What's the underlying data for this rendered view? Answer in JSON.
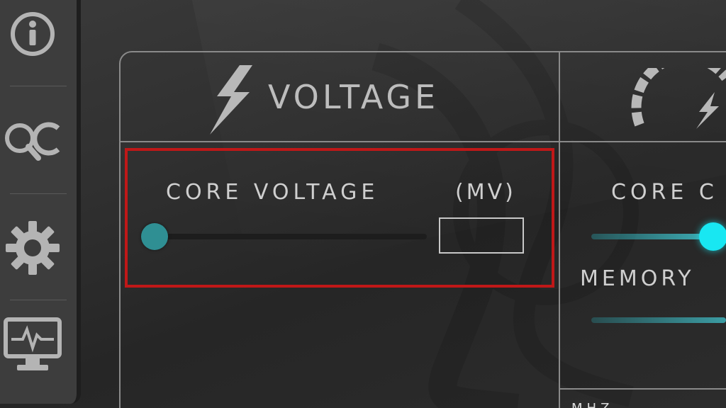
{
  "sidebar": {
    "items": [
      {
        "name": "info",
        "icon": "info-icon"
      },
      {
        "name": "oc",
        "icon": "oc-scanner-icon",
        "label": "OC"
      },
      {
        "name": "settings",
        "icon": "gear-icon"
      },
      {
        "name": "monitor",
        "icon": "monitor-pulse-icon"
      }
    ]
  },
  "voltage_panel": {
    "title": "VOLTAGE",
    "icon": "lightning-icon",
    "core_voltage": {
      "label": "CORE VOLTAGE",
      "unit": "(MV)",
      "value": "",
      "slider_fraction": 0.0
    }
  },
  "clock_panel": {
    "icon": "speedometer-icon",
    "core_label": "CORE C",
    "memory_label": "MEMORY",
    "bottom_text": "MHZ"
  },
  "colors": {
    "highlight": "#c01818",
    "accent_teal": "#2f8f93",
    "accent_cyan": "#18e7f2"
  }
}
